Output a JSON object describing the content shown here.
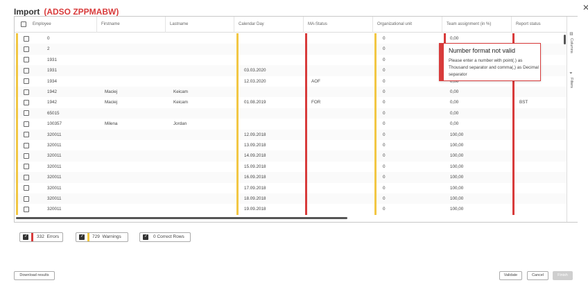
{
  "dialog": {
    "title": "Import",
    "subtitle": "(ADSO ZPPMABW)"
  },
  "columns": [
    "Employee",
    "Firstname",
    "Lastname",
    "Calendar Day",
    "MA-Status",
    "Organizational unit",
    "Team assignment (in %)",
    "Report status"
  ],
  "rows": [
    {
      "employee": "0",
      "firstname": "",
      "lastname": "",
      "calendar_day": "",
      "ma_status": "",
      "org_unit": "0",
      "team_assignment": "0,00",
      "report_status": ""
    },
    {
      "employee": "2",
      "firstname": "",
      "lastname": "",
      "calendar_day": "",
      "ma_status": "",
      "org_unit": "0",
      "team_assignment": "0,00",
      "report_status": ""
    },
    {
      "employee": "1931",
      "firstname": "",
      "lastname": "",
      "calendar_day": "",
      "ma_status": "",
      "org_unit": "0",
      "team_assignment": "0,00",
      "report_status": ""
    },
    {
      "employee": "1931",
      "firstname": "",
      "lastname": "",
      "calendar_day": "03.03.2020",
      "ma_status": "",
      "org_unit": "0",
      "team_assignment": "0,00",
      "report_status": ""
    },
    {
      "employee": "1934",
      "firstname": "",
      "lastname": "",
      "calendar_day": "12.03.2020",
      "ma_status": "AOF",
      "org_unit": "0",
      "team_assignment": "0,00",
      "report_status": ""
    },
    {
      "employee": "1942",
      "firstname": "Maciej",
      "lastname": "Keicam",
      "calendar_day": "",
      "ma_status": "",
      "org_unit": "0",
      "team_assignment": "0,00",
      "report_status": ""
    },
    {
      "employee": "1942",
      "firstname": "Maciej",
      "lastname": "Keicam",
      "calendar_day": "01.08.2019",
      "ma_status": "FOR",
      "org_unit": "0",
      "team_assignment": "0,00",
      "report_status": "BST"
    },
    {
      "employee": "65015",
      "firstname": "",
      "lastname": "",
      "calendar_day": "",
      "ma_status": "",
      "org_unit": "0",
      "team_assignment": "0,00",
      "report_status": ""
    },
    {
      "employee": "100357",
      "firstname": "Milena",
      "lastname": "Jordan",
      "calendar_day": "",
      "ma_status": "",
      "org_unit": "0",
      "team_assignment": "0,00",
      "report_status": ""
    },
    {
      "employee": "320011",
      "firstname": "",
      "lastname": "",
      "calendar_day": "12.09.2018",
      "ma_status": "",
      "org_unit": "0",
      "team_assignment": "100,00",
      "report_status": ""
    },
    {
      "employee": "320011",
      "firstname": "",
      "lastname": "",
      "calendar_day": "13.09.2018",
      "ma_status": "",
      "org_unit": "0",
      "team_assignment": "100,00",
      "report_status": ""
    },
    {
      "employee": "320011",
      "firstname": "",
      "lastname": "",
      "calendar_day": "14.09.2018",
      "ma_status": "",
      "org_unit": "0",
      "team_assignment": "100,00",
      "report_status": ""
    },
    {
      "employee": "320011",
      "firstname": "",
      "lastname": "",
      "calendar_day": "15.09.2018",
      "ma_status": "",
      "org_unit": "0",
      "team_assignment": "100,00",
      "report_status": ""
    },
    {
      "employee": "320011",
      "firstname": "",
      "lastname": "",
      "calendar_day": "16.09.2018",
      "ma_status": "",
      "org_unit": "0",
      "team_assignment": "100,00",
      "report_status": ""
    },
    {
      "employee": "320011",
      "firstname": "",
      "lastname": "",
      "calendar_day": "17.09.2018",
      "ma_status": "",
      "org_unit": "0",
      "team_assignment": "100,00",
      "report_status": ""
    },
    {
      "employee": "320011",
      "firstname": "",
      "lastname": "",
      "calendar_day": "18.09.2018",
      "ma_status": "",
      "org_unit": "0",
      "team_assignment": "100,00",
      "report_status": ""
    },
    {
      "employee": "320011",
      "firstname": "",
      "lastname": "",
      "calendar_day": "19.09.2018",
      "ma_status": "",
      "org_unit": "0",
      "team_assignment": "100,00",
      "report_status": ""
    }
  ],
  "side_tabs": {
    "columns": "Columns",
    "filters": "Filters",
    "columns_icon": "columns-icon",
    "filters_icon": "filter-icon"
  },
  "tooltip": {
    "title": "Number format not valid",
    "body": "Please enter a number with point(.) as Thousand separator and comma(,) as Decimal separator"
  },
  "filters": {
    "errors": {
      "count": "332",
      "label": "Errors",
      "color": "#d83b3b"
    },
    "warnings": {
      "count": "729",
      "label": "Warnings",
      "color": "#f2c744"
    },
    "correct": {
      "count": "0",
      "label": "Correct Rows"
    }
  },
  "buttons": {
    "download": "Download results",
    "validate": "Validate",
    "cancel": "Cancel",
    "finish": "Finish"
  },
  "colors": {
    "error": "#d83b3b",
    "warning": "#f2c744"
  }
}
